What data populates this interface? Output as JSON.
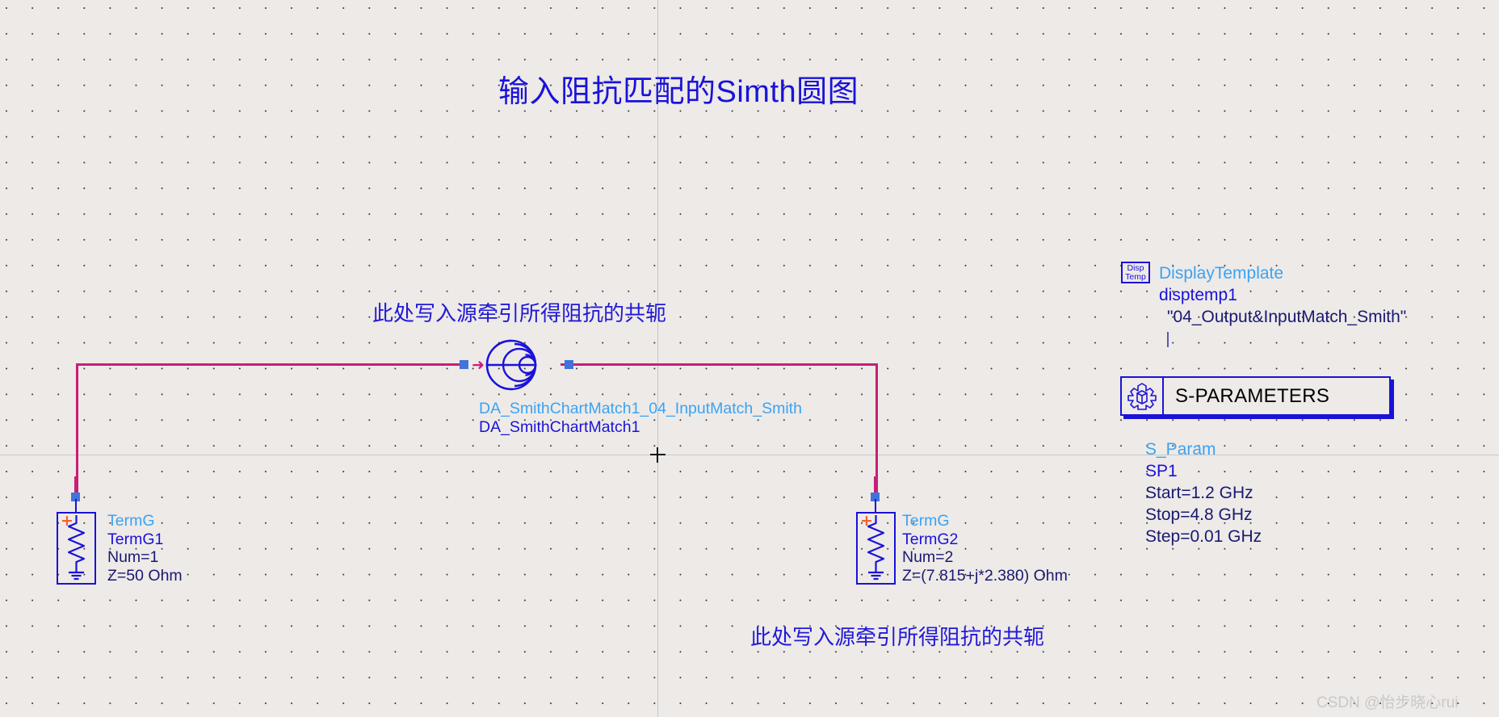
{
  "schematic": {
    "title": "输入阻抗匹配的Simth圆图",
    "annotation_top": "此处写入源牵引所得阻抗的共轭",
    "annotation_bottom": "此处写入源牵引所得阻抗的共轭",
    "watermark": "CSDN @怡步晓心rui",
    "colors": {
      "background": "#edeae8",
      "wire": "#c81e78",
      "symbol": "#1a12d8",
      "instance_label": "#1a12d8",
      "type_label": "#3ba3f2",
      "param_label": "#191970",
      "node": "#3f74db",
      "plus_sign": "#f0622a",
      "guide": "#c7c9c7",
      "watermark": "#c9c9c9"
    }
  },
  "smith_component": {
    "type_label": "DA_SmithChartMatch1_04_InputMatch_Smith",
    "instance_label": "DA_SmithChartMatch1",
    "icon": "smith-chart-icon"
  },
  "term_left": {
    "type_label": "TermG",
    "instance_label": "TermG1",
    "params": [
      "Num=1",
      "Z=50 Ohm"
    ],
    "plus": "+",
    "icon": "terminal-ground-icon"
  },
  "term_right": {
    "type_label": "TermG",
    "instance_label": "TermG2",
    "params": [
      "Num=2",
      "Z=(7.815+j*2.380) Ohm"
    ],
    "plus": "+",
    "icon": "terminal-ground-icon"
  },
  "display_template": {
    "icon_line1": "Disp",
    "icon_line2": "Temp",
    "type_label": "DisplayTemplate",
    "instance_label": "disptemp1",
    "params": [
      "\"04_Output&InputMatch_Smith\""
    ]
  },
  "s_parameters": {
    "block_title": "S-PARAMETERS",
    "icon": "s-parameters-gear-icon",
    "type_label": "S_Param",
    "instance_label": "SP1",
    "params": [
      "Start=1.2 GHz",
      "Stop=4.8 GHz",
      "Step=0.01 GHz"
    ]
  }
}
